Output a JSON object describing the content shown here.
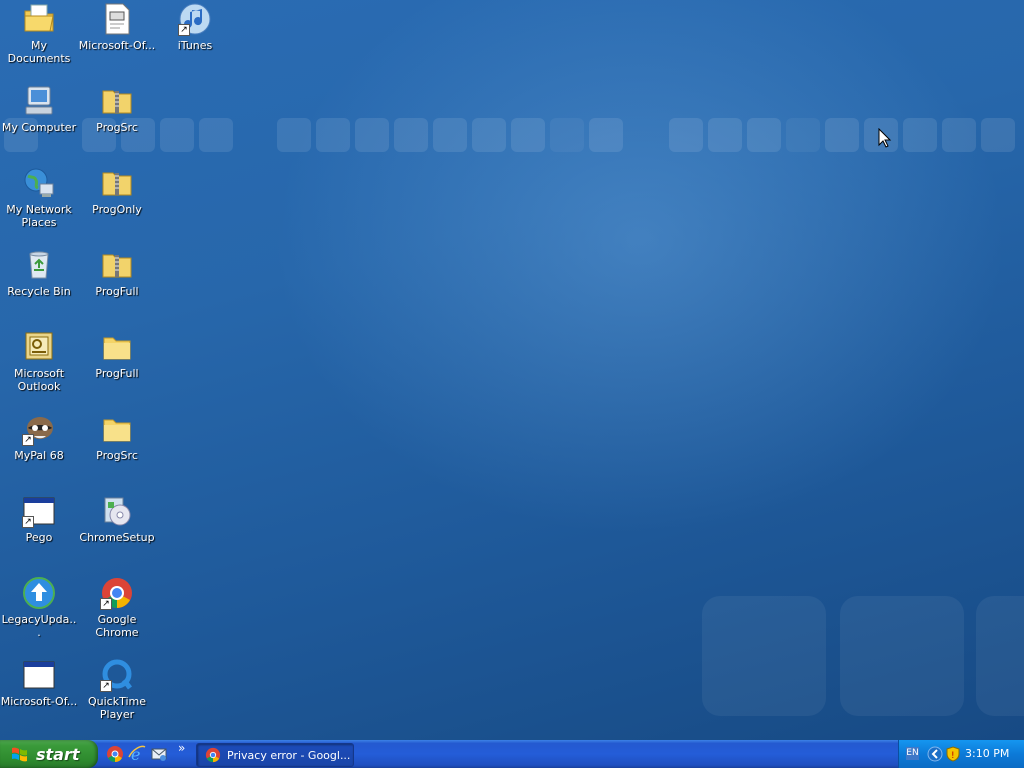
{
  "desktop": {
    "icons": [
      {
        "label": "My Documents",
        "icon": "my-documents-icon"
      },
      {
        "label": "Microsoft-Of...",
        "icon": "document-icon"
      },
      {
        "label": "iTunes",
        "icon": "itunes-icon"
      },
      {
        "label": "My Computer",
        "icon": "my-computer-icon"
      },
      {
        "label": "ProgSrc",
        "icon": "zip-folder-icon"
      },
      {
        "label": "My Network Places",
        "icon": "network-places-icon"
      },
      {
        "label": "ProgOnly",
        "icon": "zip-folder-icon"
      },
      {
        "label": "Recycle Bin",
        "icon": "recycle-bin-icon"
      },
      {
        "label": "ProgFull",
        "icon": "zip-folder-icon"
      },
      {
        "label": "Microsoft Outlook",
        "icon": "outlook-icon"
      },
      {
        "label": "ProgFull",
        "icon": "folder-icon"
      },
      {
        "label": "MyPal 68",
        "icon": "mypal-icon"
      },
      {
        "label": "ProgSrc",
        "icon": "folder-icon"
      },
      {
        "label": "Pego",
        "icon": "window-app-icon"
      },
      {
        "label": "ChromeSetup",
        "icon": "setup-icon"
      },
      {
        "label": "LegacyUpda...",
        "icon": "update-icon"
      },
      {
        "label": "Google Chrome",
        "icon": "chrome-icon"
      },
      {
        "label": "Microsoft-Of...",
        "icon": "window-app-icon"
      },
      {
        "label": "QuickTime Player",
        "icon": "quicktime-icon"
      }
    ]
  },
  "taskbar": {
    "start_label": "start",
    "quick_launch": [
      "chrome-icon",
      "internet-explorer-icon",
      "outlook-express-icon"
    ],
    "overflow_label": "»",
    "task_button_label": "Privacy error - Googl...",
    "tray": {
      "language": "EN",
      "clock": "3:10 PM"
    }
  }
}
